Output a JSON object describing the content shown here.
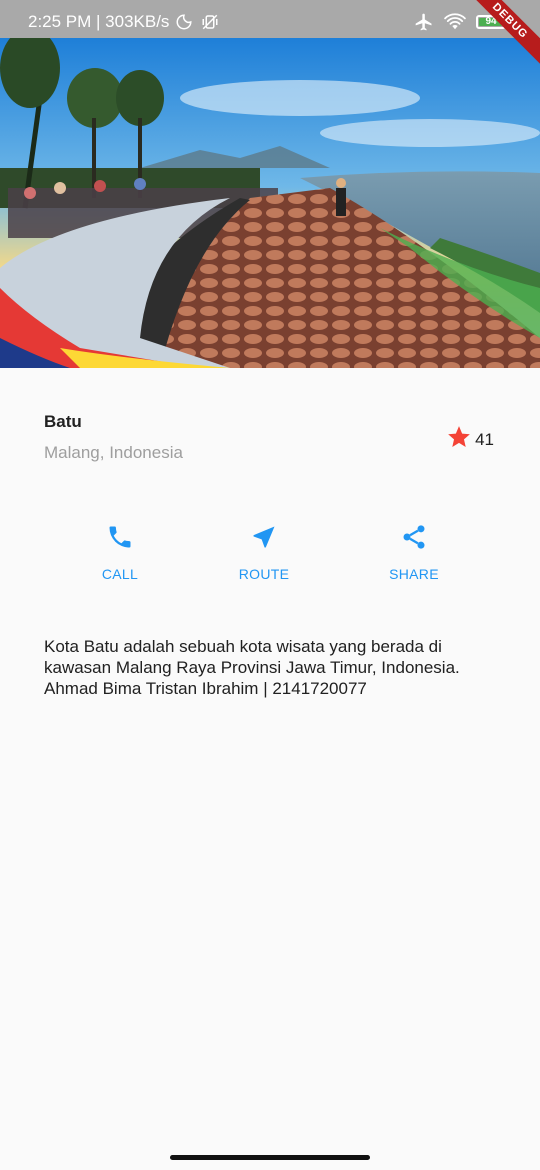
{
  "status_bar": {
    "time_speed": "2:25 PM | 303KB/s",
    "battery_level": "94",
    "icons": [
      "moon-icon",
      "vibrate-off-icon",
      "airplane-icon",
      "wifi-icon",
      "battery-icon"
    ]
  },
  "debug_banner": "DEBUG",
  "hero": {
    "icon": "paragliding-viewpoint-photo"
  },
  "place": {
    "name": "Batu",
    "location": "Malang, Indonesia",
    "rating_count": "41",
    "star_color": "#f44336"
  },
  "actions": [
    {
      "label": "CALL",
      "icon": "phone-icon"
    },
    {
      "label": "ROUTE",
      "icon": "near-me-icon"
    },
    {
      "label": "SHARE",
      "icon": "share-icon"
    }
  ],
  "accent_color": "#2196f3",
  "description": "Kota Batu adalah sebuah kota wisata yang berada di kawasan Malang Raya Provinsi Jawa Timur, Indonesia. Ahmad Bima Tristan Ibrahim | 2141720077"
}
